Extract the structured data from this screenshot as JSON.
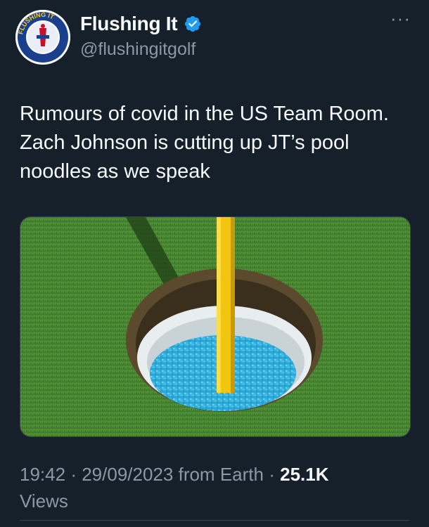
{
  "author": {
    "display_name": "Flushing It",
    "handle": "@flushingitgolf",
    "avatar_ring_text": "FLUSHING IT"
  },
  "more_label": "···",
  "tweet": {
    "text": "Rumours of covid in the US Team Room. Zach Johnson is cutting up JT’s pool noodles as we speak"
  },
  "media": {
    "description_icon": "golf-hole-photo"
  },
  "meta": {
    "time": "19:42",
    "sep1": "·",
    "date": "29/09/2023",
    "source": "from Earth",
    "sep2": "·",
    "views_count": "25.1K",
    "views_label": "Views"
  },
  "colors": {
    "background": "#15202b",
    "text": "#f7f9f9",
    "secondary": "#8b98a5",
    "verified": "#1d9bf0"
  }
}
